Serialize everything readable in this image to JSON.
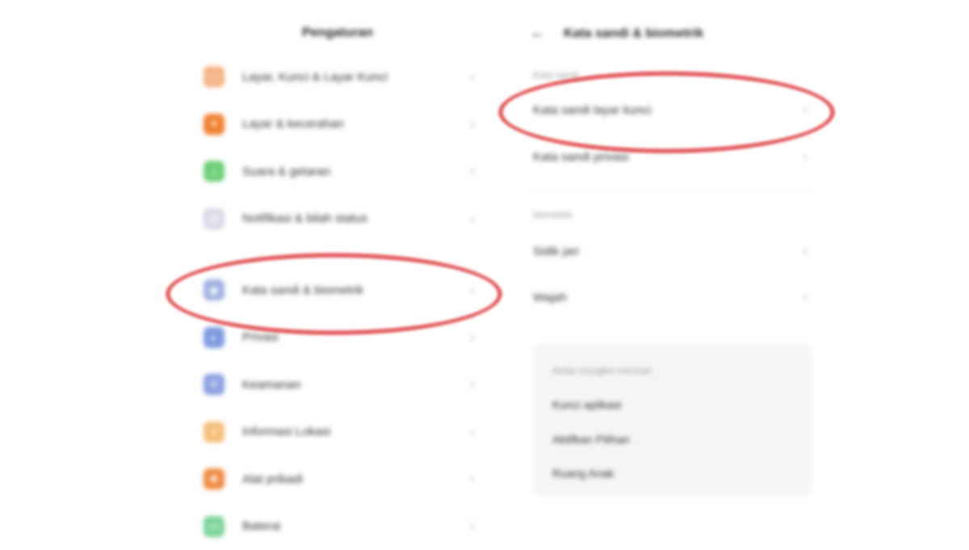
{
  "left": {
    "title": "Pengaturan",
    "items": [
      {
        "label": "Layar, Kunci & Layar Kunci",
        "icon": "lock-screen-icon",
        "color": "#f4b183"
      },
      {
        "label": "Layar & kecerahan",
        "icon": "brightness-icon",
        "color": "#f08030"
      },
      {
        "label": "Suara & getaran",
        "icon": "sound-icon",
        "color": "#6fcf7a"
      },
      {
        "label": "Notifikasi & bilah status",
        "icon": "notification-icon",
        "color": "#c8c8d8"
      },
      {
        "label": "Kata sandi & biometrik",
        "icon": "password-icon",
        "color": "#7b95d6"
      },
      {
        "label": "Privasi",
        "icon": "privacy-icon",
        "color": "#5b84d6"
      },
      {
        "label": "Keamanan",
        "icon": "security-icon",
        "color": "#6a86d8"
      },
      {
        "label": "Informasi Lokasi",
        "icon": "location-icon",
        "color": "#f6b76a"
      },
      {
        "label": "Alat pribadi",
        "icon": "tools-icon",
        "color": "#f08a40"
      },
      {
        "label": "Baterai",
        "icon": "battery-icon",
        "color": "#6fcf90"
      }
    ]
  },
  "right": {
    "back_icon": "back-arrow-icon",
    "title": "Kata sandi & biometrik",
    "section1_label": "Kata sandi",
    "rows1": [
      {
        "label": "Kata sandi layar kunci"
      },
      {
        "label": "Kata sandi privasi"
      }
    ],
    "section2_label": "biometrik",
    "rows2": [
      {
        "label": "Sidik jari"
      },
      {
        "label": "Wajah"
      }
    ],
    "card": {
      "title": "Anda mungkin mencari",
      "links": [
        "Kunci aplikasi",
        "Aktifkan Pilihan",
        "Ruang Anak"
      ]
    }
  },
  "colors": {
    "highlight": "#e0484a",
    "card_bg": "#f5f5f5"
  }
}
